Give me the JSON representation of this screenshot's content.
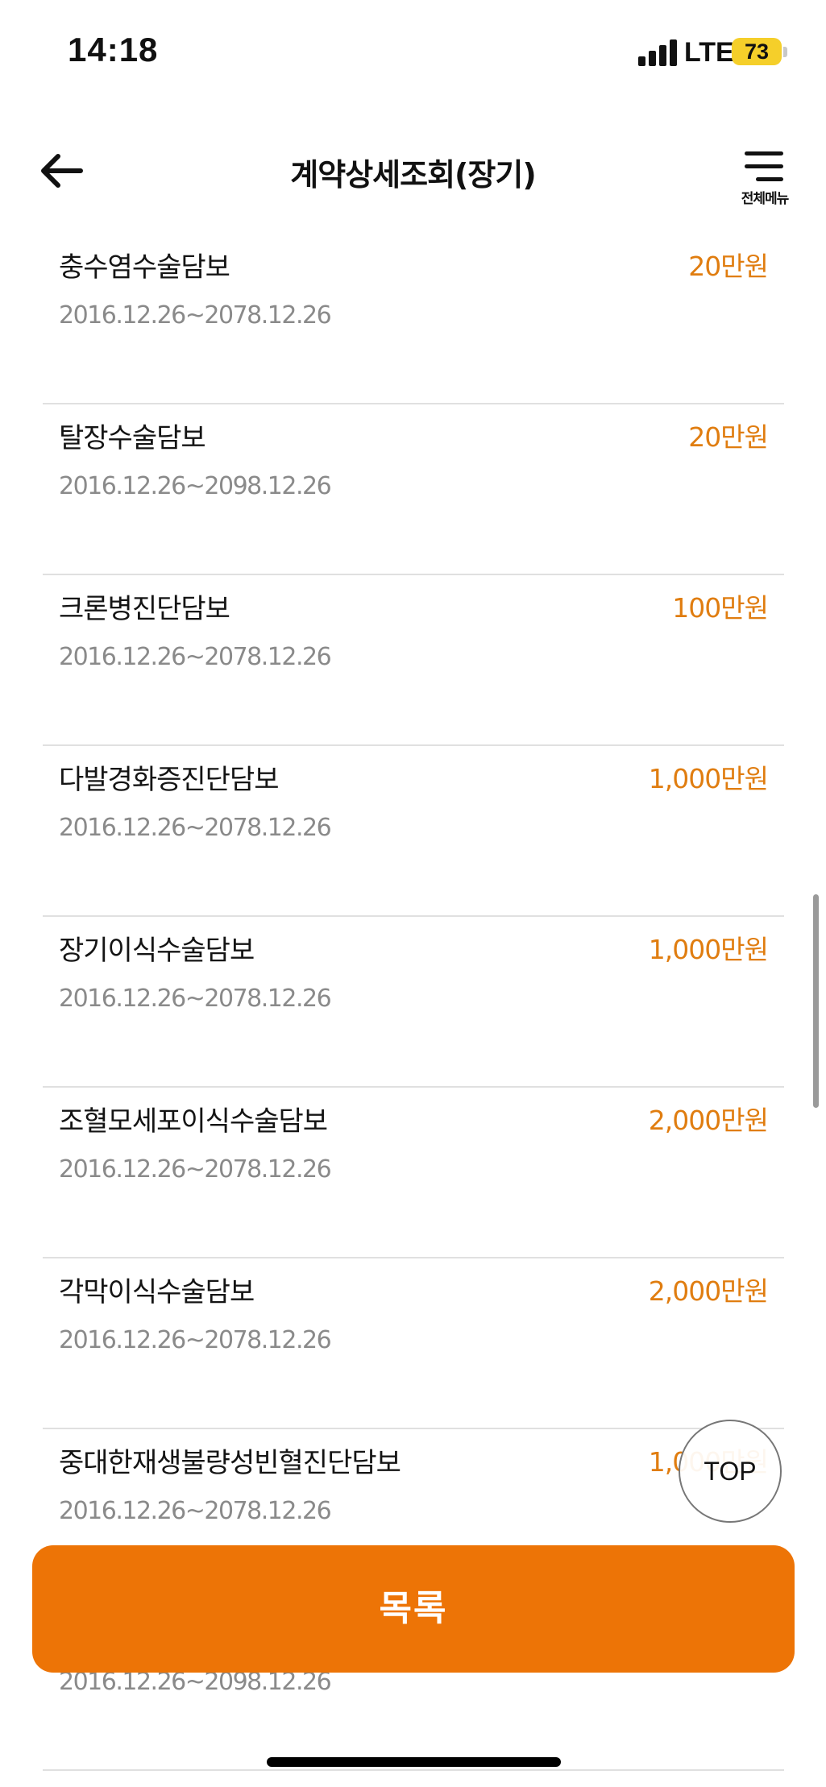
{
  "status_bar": {
    "time": "14:18",
    "network": "LTE",
    "battery": "73",
    "battery_color": "#f5cf2a"
  },
  "header": {
    "title": "계약상세조회(장기)",
    "back_icon": "arrow-left-icon",
    "menu_icon": "hamburger-icon",
    "menu_label": "전체메뉴"
  },
  "coverages": [
    {
      "name": "충수염수술담보",
      "amount": "20만원",
      "period": "2016.12.26~2078.12.26"
    },
    {
      "name": "탈장수술담보",
      "amount": "20만원",
      "period": "2016.12.26~2098.12.26"
    },
    {
      "name": "크론병진단담보",
      "amount": "100만원",
      "period": "2016.12.26~2078.12.26"
    },
    {
      "name": "다발경화증진단담보",
      "amount": "1,000만원",
      "period": "2016.12.26~2078.12.26"
    },
    {
      "name": "장기이식수술담보",
      "amount": "1,000만원",
      "period": "2016.12.26~2078.12.26"
    },
    {
      "name": "조혈모세포이식수술담보",
      "amount": "2,000만원",
      "period": "2016.12.26~2078.12.26"
    },
    {
      "name": "각막이식수술담보",
      "amount": "2,000만원",
      "period": "2016.12.26~2078.12.26"
    },
    {
      "name": "중대한재생불량성빈혈진단담보",
      "amount": "1,000만원",
      "period": "2016.12.26~2078.12.26"
    },
    {
      "name": "",
      "amount": "",
      "period": "2016.12.26~2098.12.26"
    }
  ],
  "top_button": {
    "label": "TOP"
  },
  "list_button": {
    "label": "목록"
  },
  "colors": {
    "accent": "#ed7406",
    "amount": "#e07d10"
  }
}
